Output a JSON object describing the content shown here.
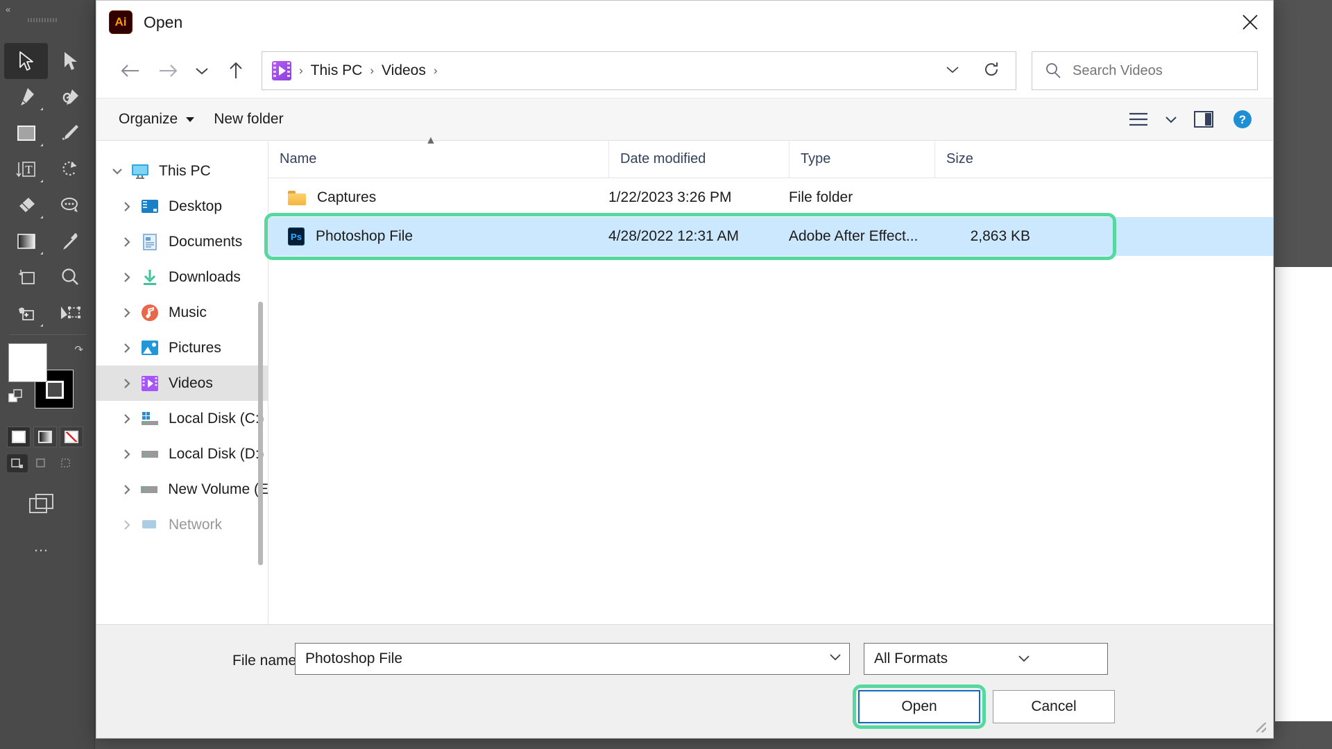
{
  "window": {
    "title": "Open",
    "app_badge": "Ai",
    "close_label": "Close"
  },
  "navbar": {
    "back_icon": "back-arrow-icon",
    "forward_icon": "forward-arrow-icon",
    "recent_icon": "chevron-down-icon",
    "up_icon": "up-arrow-icon",
    "breadcrumb": [
      "This PC",
      "Videos"
    ],
    "address_chevron": "chevron-down-icon",
    "refresh_icon": "refresh-icon",
    "search": {
      "placeholder": "Search Videos",
      "value": "",
      "icon": "search-icon"
    }
  },
  "commandbar": {
    "organize": "Organize",
    "new_folder": "New folder",
    "view_icon": "list-view-icon",
    "view_chevron": "chevron-down-icon",
    "preview_icon": "preview-pane-icon",
    "help_icon": "help-icon"
  },
  "sidebar": {
    "items": [
      {
        "label": "This PC",
        "icon": "monitor-icon",
        "level": 0,
        "expanded": true,
        "selected": false
      },
      {
        "label": "Desktop",
        "icon": "desktop-icon",
        "level": 1,
        "expanded": false,
        "selected": false
      },
      {
        "label": "Documents",
        "icon": "documents-icon",
        "level": 1,
        "expanded": false,
        "selected": false
      },
      {
        "label": "Downloads",
        "icon": "downloads-icon",
        "level": 1,
        "expanded": false,
        "selected": false
      },
      {
        "label": "Music",
        "icon": "music-icon",
        "level": 1,
        "expanded": false,
        "selected": false
      },
      {
        "label": "Pictures",
        "icon": "pictures-icon",
        "level": 1,
        "expanded": false,
        "selected": false
      },
      {
        "label": "Videos",
        "icon": "videos-icon",
        "level": 1,
        "expanded": false,
        "selected": true
      },
      {
        "label": "Local Disk (C:)",
        "icon": "windows-disk-icon",
        "level": 1,
        "expanded": false,
        "selected": false
      },
      {
        "label": "Local Disk (D:)",
        "icon": "disk-icon",
        "level": 1,
        "expanded": false,
        "selected": false
      },
      {
        "label": "New Volume (E",
        "icon": "disk-icon",
        "level": 1,
        "expanded": false,
        "selected": false
      },
      {
        "label": "Network",
        "icon": "network-icon",
        "level": 0,
        "expanded": false,
        "selected": false
      }
    ]
  },
  "filelist": {
    "columns": [
      "Name",
      "Date modified",
      "Type",
      "Size"
    ],
    "sort_column": "Name",
    "sort_caret": "▲",
    "rows": [
      {
        "name": "Captures",
        "date": "1/22/2023 3:26 PM",
        "type": "File folder",
        "size": "",
        "icon": "folder-icon",
        "selected": false,
        "highlighted": false
      },
      {
        "name": "Photoshop File",
        "date": "4/28/2022 12:31 AM",
        "type": "Adobe After Effect...",
        "size": "2,863 KB",
        "icon": "photoshop-file-icon",
        "selected": true,
        "highlighted": true
      }
    ]
  },
  "footer": {
    "filename_label": "File name:",
    "filename_value": "Photoshop File",
    "filename_chevron": "chevron-down-icon",
    "format_value": "All Formats",
    "format_chevron": "chevron-down-icon",
    "open_button": "Open",
    "cancel_button": "Cancel"
  },
  "highlight": {
    "color": "#56d8a0",
    "targets": [
      "selected-file-row",
      "open-button"
    ]
  },
  "illustrator": {
    "tools": [
      "selection-tool",
      "direct-selection-tool",
      "pen-tool",
      "curvature-pen-tool",
      "rectangle-tool",
      "paintbrush-tool",
      "type-tool",
      "rotate-tool",
      "eraser-tool",
      "lasso-tool",
      "gradient-tool",
      "eyedropper-tool",
      "artboard-tool",
      "zoom-tool",
      "shape-builder-tool",
      "free-transform-tool"
    ],
    "active_tool": "selection-tool",
    "fill_color": "#ffffff",
    "stroke_color": "#000000",
    "more_tools": "…"
  }
}
